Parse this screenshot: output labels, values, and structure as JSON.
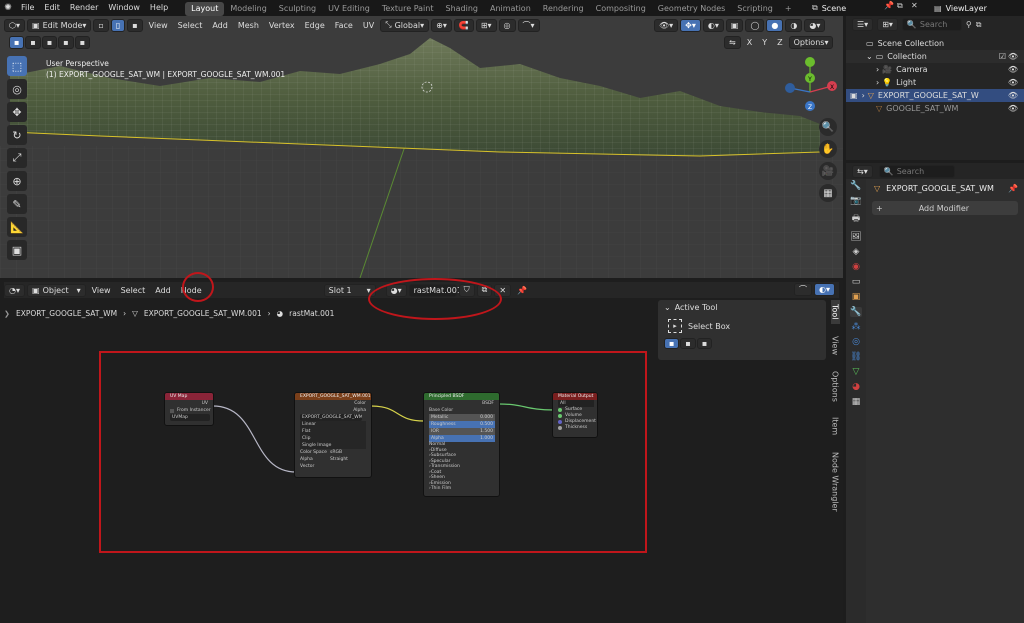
{
  "topbar": {
    "menus": [
      "File",
      "Edit",
      "Render",
      "Window",
      "Help"
    ],
    "workspaces": [
      "Layout",
      "Modeling",
      "Sculpting",
      "UV Editing",
      "Texture Paint",
      "Shading",
      "Animation",
      "Rendering",
      "Compositing",
      "Geometry Nodes",
      "Scripting"
    ],
    "active_workspace": "Layout",
    "add_tab": "+",
    "scene": "Scene",
    "view_layer": "ViewLayer"
  },
  "viewport": {
    "mode": "Edit Mode",
    "menus": [
      "View",
      "Select",
      "Add",
      "Mesh",
      "Vertex",
      "Edge",
      "Face",
      "UV"
    ],
    "orientation": "Global",
    "perspective": "User Perspective",
    "object_info": "(1) EXPORT_GOOGLE_SAT_WM | EXPORT_GOOGLE_SAT_WM.001",
    "axes": [
      "X",
      "Y",
      "Z"
    ],
    "options": "Options",
    "gizmo": {
      "x": "X",
      "y": "Y",
      "z": "Z"
    }
  },
  "node_editor": {
    "editor_type": "Object",
    "menus": [
      "View",
      "Select",
      "Add",
      "Node"
    ],
    "slot": "Slot 1",
    "material": "rastMat.001",
    "breadcrumb": [
      "EXPORT_GOOGLE_SAT_WM",
      "EXPORT_GOOGLE_SAT_WM.001",
      "rastMat.001"
    ],
    "active_tool_title": "Active Tool",
    "active_tool": "Select Box",
    "side_tabs": [
      "Tool",
      "View",
      "Options",
      "Item",
      "Node Wrangler"
    ],
    "nodes": {
      "uv": {
        "title": "UV Map",
        "out": "UV",
        "from_instancer": "From Instancer",
        "map": "UVMap"
      },
      "image": {
        "title": "EXPORT_GOOGLE_SAT_WM.001",
        "out_color": "Color",
        "out_alpha": "Alpha",
        "image_name": "EXPORT_GOOGLE_SAT_WM",
        "fields": [
          "Linear",
          "Flat",
          "Clip",
          "Single Image"
        ],
        "colorspace_label": "Color Space",
        "colorspace": "sRGB",
        "alpha_label": "Alpha",
        "alpha": "Straight",
        "vector": "Vector"
      },
      "bsdf": {
        "title": "Principled BSDF",
        "out": "BSDF",
        "rows": [
          "Base Color",
          "Metallic",
          "Roughness",
          "IOR",
          "Alpha"
        ],
        "values": [
          "0.000",
          "0.500",
          "1.500",
          "1.000"
        ],
        "panels": [
          "Normal",
          "Diffuse",
          "Subsurface",
          "Specular",
          "Transmission",
          "Coat",
          "Sheen",
          "Emission",
          "Thin Film"
        ]
      },
      "output": {
        "title": "Material Output",
        "target": "All",
        "inputs": [
          "Surface",
          "Volume",
          "Displacement",
          "Thickness"
        ]
      }
    }
  },
  "outliner": {
    "search_placeholder": "Search",
    "root": "Scene Collection",
    "collection": "Collection",
    "items": [
      "Camera",
      "Light",
      "EXPORT_GOOGLE_SAT_W",
      "GOOGLE_SAT_WM"
    ]
  },
  "properties": {
    "search_placeholder": "Search",
    "object_name": "EXPORT_GOOGLE_SAT_WM",
    "add_modifier": "Add Modifier"
  },
  "colors": {
    "accent": "#4772b3",
    "annotation": "#c0161b",
    "header_bsdf": "#2e6b2e",
    "header_image": "#7a3f1a",
    "header_uv": "#8a2438",
    "header_output": "#7a1f1f"
  }
}
